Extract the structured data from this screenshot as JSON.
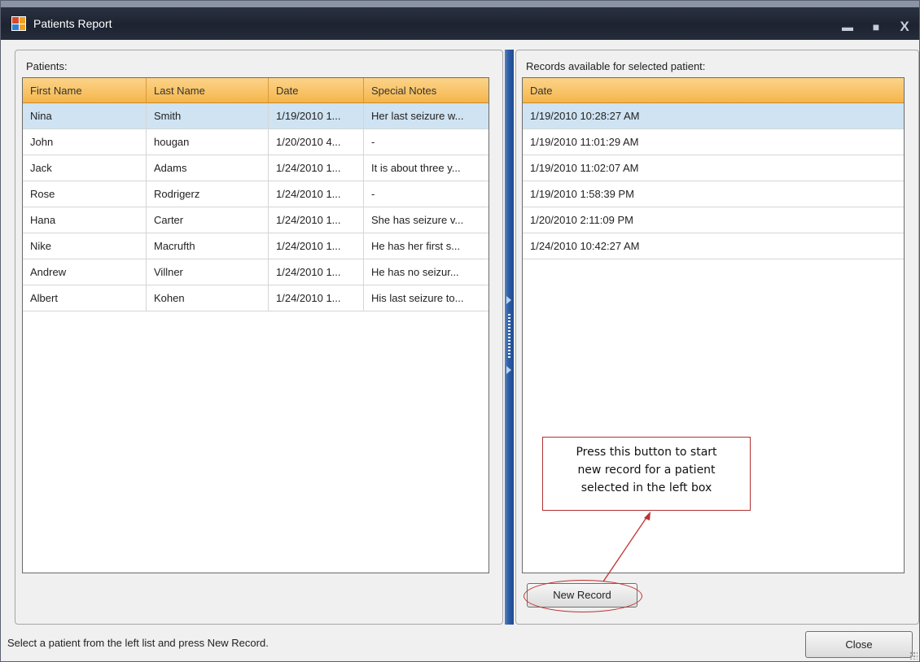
{
  "window": {
    "title": "Patients Report",
    "minimize_glyph": "▬",
    "maximize_glyph": "■",
    "close_glyph": "X"
  },
  "patients": {
    "caption": "Patients:",
    "columns": [
      "First Name",
      "Last Name",
      "Date",
      "Special Notes"
    ],
    "rows": [
      [
        "Nina",
        "Smith",
        "1/19/2010 1...",
        "Her last seizure w..."
      ],
      [
        "John",
        "hougan",
        "1/20/2010 4...",
        "-"
      ],
      [
        "Jack",
        "Adams",
        "1/24/2010 1...",
        "It is about three y..."
      ],
      [
        "Rose",
        "Rodrigerz",
        "1/24/2010 1...",
        "-"
      ],
      [
        "Hana",
        "Carter",
        "1/24/2010 1...",
        "She has seizure v..."
      ],
      [
        "Nike",
        "Macrufth",
        "1/24/2010 1...",
        "He has her first s..."
      ],
      [
        "Andrew",
        "Villner",
        "1/24/2010 1...",
        "He has no seizur..."
      ],
      [
        "Albert",
        "Kohen",
        "1/24/2010 1...",
        "His last seizure to..."
      ]
    ]
  },
  "records": {
    "caption": "Records available for selected patient:",
    "column": "Date",
    "rows": [
      "1/19/2010 10:28:27 AM",
      "1/19/2010 11:01:29 AM",
      "1/19/2010 11:02:07 AM",
      "1/19/2010 1:58:39 PM",
      "1/20/2010 2:11:09 PM",
      "1/24/2010 10:42:27 AM"
    ]
  },
  "buttons": {
    "new_record": "New Record",
    "close": "Close"
  },
  "callout": {
    "line1": "Press this button to start",
    "line2": "new record for a patient",
    "line3": "selected in the left box"
  },
  "status": "Select a patient from the left list and press New Record.",
  "colors": {
    "header_orange": "#f5b54a",
    "selection": "#cfe3f2",
    "splitter": "#2e5fa8",
    "annotation": "#c03030"
  }
}
